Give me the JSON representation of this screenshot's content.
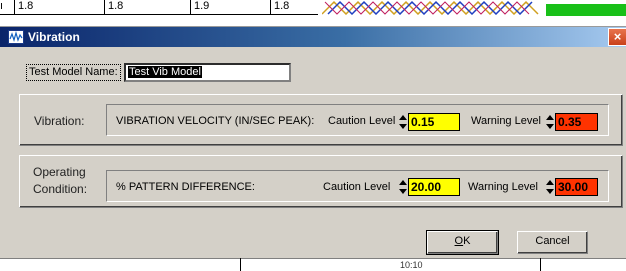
{
  "background": {
    "cells": [
      "1.8",
      "1.8",
      "1.9",
      "1.8"
    ],
    "bottom_text": "10:10",
    "colors": {
      "green_bar": "#18c018",
      "wave": [
        "#d0a020",
        "#2040c0",
        "#c02060"
      ]
    }
  },
  "window": {
    "title": "Vibration",
    "icon": "waveform-icon",
    "close_label": "×",
    "colors": {
      "title_start": "#0a246a",
      "title_end": "#a6caf0",
      "close": "#e0552b"
    }
  },
  "model": {
    "label": "Test Model Name:",
    "value": "Test Vib Model"
  },
  "vibration": {
    "label": "Vibration:",
    "description": "VIBRATION VELOCITY (IN/SEC PEAK):",
    "caution_label": "Caution Level",
    "caution_value": "0.15",
    "warning_label": "Warning Level",
    "warning_value": "0.35"
  },
  "operating": {
    "label_line1": "Operating",
    "label_line2": "Condition:",
    "description": "% PATTERN DIFFERENCE:",
    "caution_label": "Caution Level",
    "caution_value": "20.00",
    "warning_label": "Warning Level",
    "warning_value": "30.00"
  },
  "status_colors": {
    "caution": "#ffff00",
    "warning": "#ff3300"
  },
  "buttons": {
    "ok_mnemonic": "O",
    "ok_rest": "K",
    "cancel_label": "Cancel"
  }
}
